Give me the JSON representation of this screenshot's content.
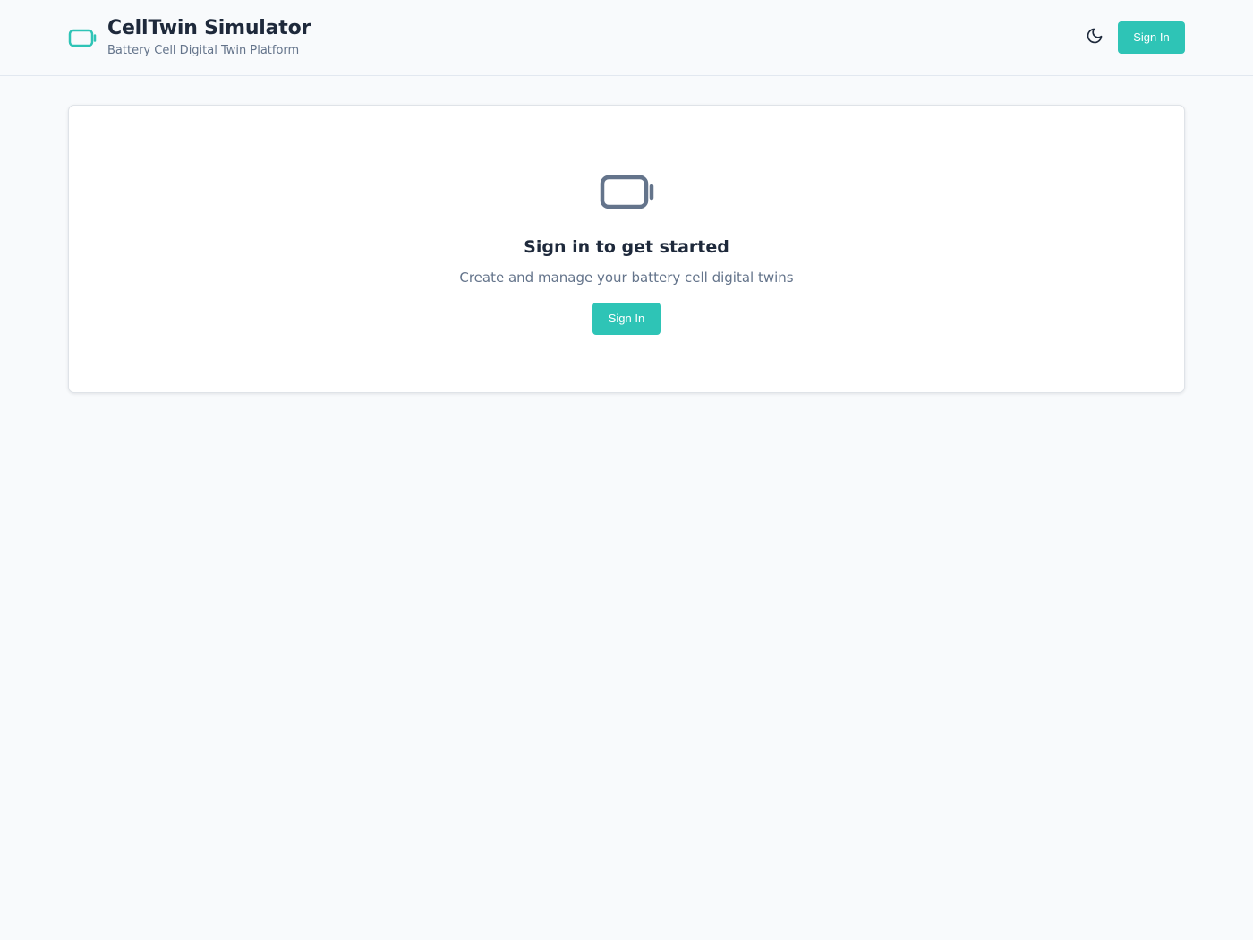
{
  "header": {
    "title": "CellTwin Simulator",
    "subtitle": "Battery Cell Digital Twin Platform",
    "logo_icon": "battery-icon",
    "theme_toggle_icon": "moon-icon",
    "signin_label": "Sign In"
  },
  "main": {
    "card": {
      "icon": "battery-icon",
      "title": "Sign in to get started",
      "description": "Create and manage your battery cell digital twins",
      "signin_label": "Sign In"
    }
  },
  "colors": {
    "accent": "#2ec4b6",
    "background": "#f8fafc",
    "card_background": "#ffffff",
    "icon_muted": "#64748b",
    "title_text": "#1e293b",
    "muted_text": "#64748b"
  }
}
